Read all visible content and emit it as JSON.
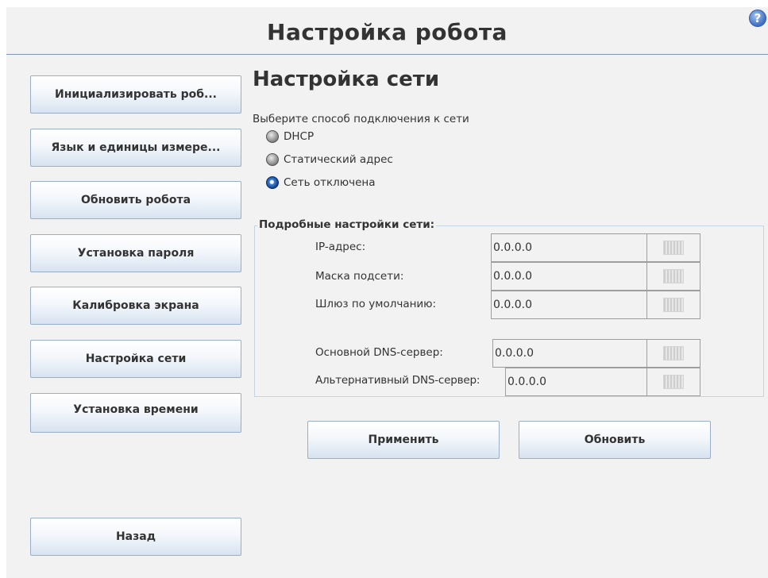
{
  "header": {
    "title": "Настройка робота",
    "help_symbol": "?"
  },
  "sidebar": {
    "items": [
      {
        "label": "Инициализировать роб..."
      },
      {
        "label": "Язык и единицы измере..."
      },
      {
        "label": "Обновить робота"
      },
      {
        "label": "Установка пароля"
      },
      {
        "label": "Калибровка экрана"
      },
      {
        "label": "Настройка сети"
      },
      {
        "label": "Установка времени"
      }
    ],
    "back_label": "Назад"
  },
  "main": {
    "title": "Настройка сети",
    "connection_prompt": "Выберите способ подключения к сети",
    "connection_options": [
      {
        "label": "DHCP",
        "selected": false
      },
      {
        "label": "Статический адрес",
        "selected": false
      },
      {
        "label": "Сеть отключена",
        "selected": true
      }
    ],
    "details": {
      "title": "Подробные настройки сети:",
      "fields": [
        {
          "label": "IP-адрес:",
          "value": "0.0.0.0"
        },
        {
          "label": "Маска подсети:",
          "value": "0.0.0.0"
        },
        {
          "label": "Шлюз по умолчанию:",
          "value": "0.0.0.0"
        },
        {
          "label": "Основной DNS-сервер:",
          "value": "0.0.0.0"
        },
        {
          "label": "Альтернативный DNS-сервер:",
          "value": "0.0.0.0"
        }
      ]
    },
    "apply_label": "Применить",
    "refresh_label": "Обновить"
  },
  "colors": {
    "background": "#f2f2f2",
    "header_divider": "#7f97b2",
    "button_gradient_bottom": "#d7e3f1",
    "selected_radio": "#3d86d8"
  },
  "icons": {
    "help": "help-icon",
    "keyboard": "keyboard-icon"
  }
}
